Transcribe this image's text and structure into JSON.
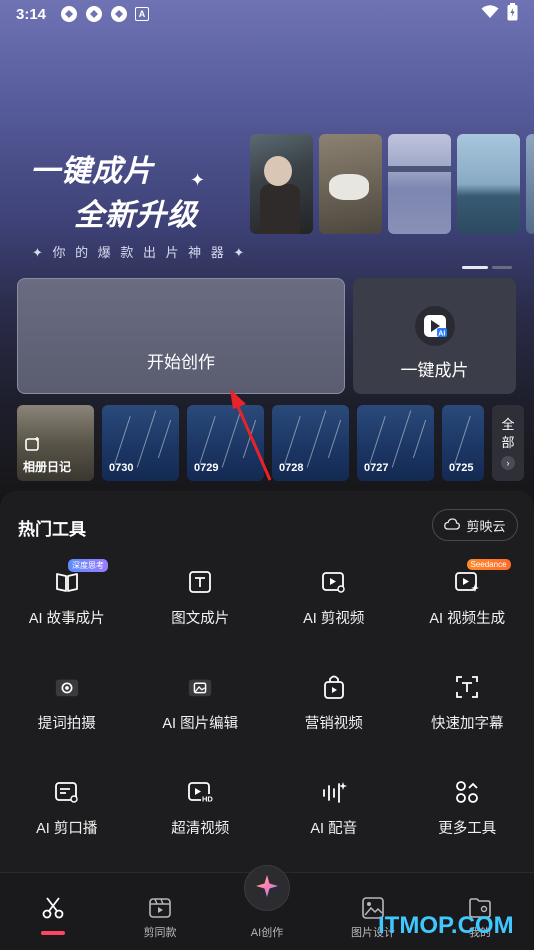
{
  "status_bar": {
    "time": "3:14",
    "indicator": "A"
  },
  "banner": {
    "line1": "一键成片",
    "line2": "全新升级",
    "tagline": "✦ 你 的 爆 款 出 片 神 器 ✦"
  },
  "cards": {
    "create_label": "开始创作",
    "onekey_label": "一键成片"
  },
  "album_strip": {
    "album_label": "相册日记",
    "dates": [
      "0730",
      "0729",
      "0728",
      "0727",
      "0725"
    ],
    "more_label_1": "全",
    "more_label_2": "部"
  },
  "hot_tools": {
    "title": "热门工具",
    "cloud_label": "剪映云",
    "tools": [
      {
        "label": "AI 故事成片",
        "icon": "book-icon",
        "tag": "深度思考"
      },
      {
        "label": "图文成片",
        "icon": "text-frame-icon"
      },
      {
        "label": "AI 剪视频",
        "icon": "video-cut-icon"
      },
      {
        "label": "AI 视频生成",
        "icon": "video-generate-icon",
        "tag": "Seedance"
      },
      {
        "label": "提词拍摄",
        "icon": "camera-icon"
      },
      {
        "label": "AI 图片编辑",
        "icon": "image-edit-icon"
      },
      {
        "label": "营销视频",
        "icon": "shopping-bag-icon"
      },
      {
        "label": "快速加字幕",
        "icon": "caption-icon"
      },
      {
        "label": "AI 剪口播",
        "icon": "script-cut-icon"
      },
      {
        "label": "超清视频",
        "icon": "hd-icon"
      },
      {
        "label": "AI 配音",
        "icon": "audio-wave-icon"
      },
      {
        "label": "更多工具",
        "icon": "more-tools-icon"
      }
    ]
  },
  "bottom_nav": {
    "items": [
      {
        "label": "",
        "icon": "scissors-icon",
        "active": true
      },
      {
        "label": "剪同款",
        "icon": "template-icon"
      },
      {
        "label": "AI创作",
        "icon": "ai-sparkle-icon"
      },
      {
        "label": "图片设计",
        "icon": "image-design-icon"
      },
      {
        "label": "我的",
        "icon": "profile-icon"
      }
    ]
  },
  "watermark": "ITMOP.COM",
  "colors": {
    "accent": "#ff4466",
    "watermark": "#3ec8ff",
    "sheet_bg": "#1d1d1f"
  }
}
